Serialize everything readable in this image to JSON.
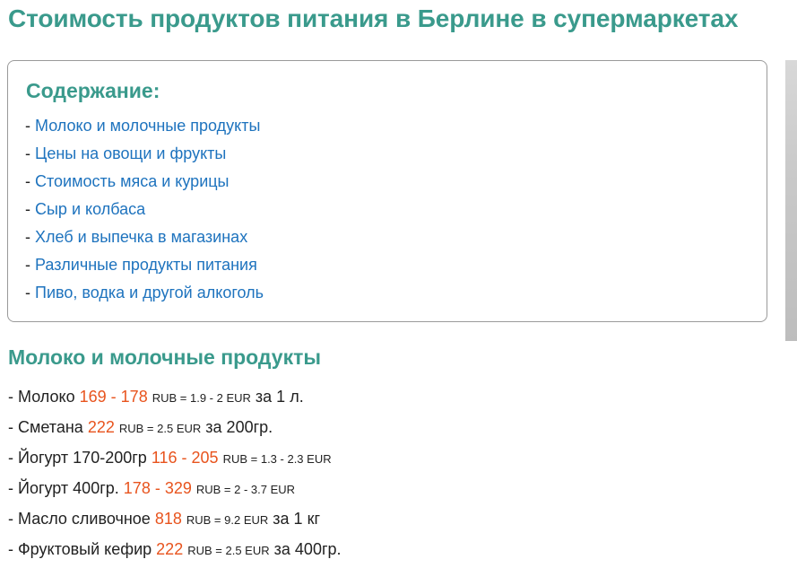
{
  "page_title": "Стоимость продуктов питания в Берлине в супермаркетах",
  "toc": {
    "title": "Содержание:",
    "items": [
      {
        "label": "Молоко и молочные продукты"
      },
      {
        "label": "Цены на овощи и фрукты"
      },
      {
        "label": "Стоимость мяса и курицы"
      },
      {
        "label": "Сыр и колбаса"
      },
      {
        "label": "Хлеб и выпечка в магазинах"
      },
      {
        "label": "Различные продукты питания"
      },
      {
        "label": "Пиво, водка и другой алкоголь"
      }
    ]
  },
  "section": {
    "title": "Молоко и молочные продукты",
    "items": [
      {
        "name": "Молоко",
        "price": "169 - 178",
        "conversion": "RUB = 1.9 - 2 EUR",
        "unit": "за 1 л."
      },
      {
        "name": "Сметана",
        "price": "222",
        "conversion": "RUB = 2.5 EUR",
        "unit": "за 200гр."
      },
      {
        "name": "Йогурт 170-200гр",
        "price": "116 - 205",
        "conversion": "RUB = 1.3 - 2.3 EUR",
        "unit": ""
      },
      {
        "name": "Йогурт 400гр.",
        "price": "178 - 329",
        "conversion": "RUB = 2 - 3.7 EUR",
        "unit": ""
      },
      {
        "name": "Масло сливочное",
        "price": "818",
        "conversion": "RUB = 9.2 EUR",
        "unit": "за 1 кг"
      },
      {
        "name": "Фруктовый кефир",
        "price": "222",
        "conversion": "RUB = 2.5 EUR",
        "unit": "за 400гр."
      }
    ]
  },
  "colors": {
    "heading": "#3a9a8c",
    "link": "#1e73be",
    "price": "#e8541e"
  }
}
